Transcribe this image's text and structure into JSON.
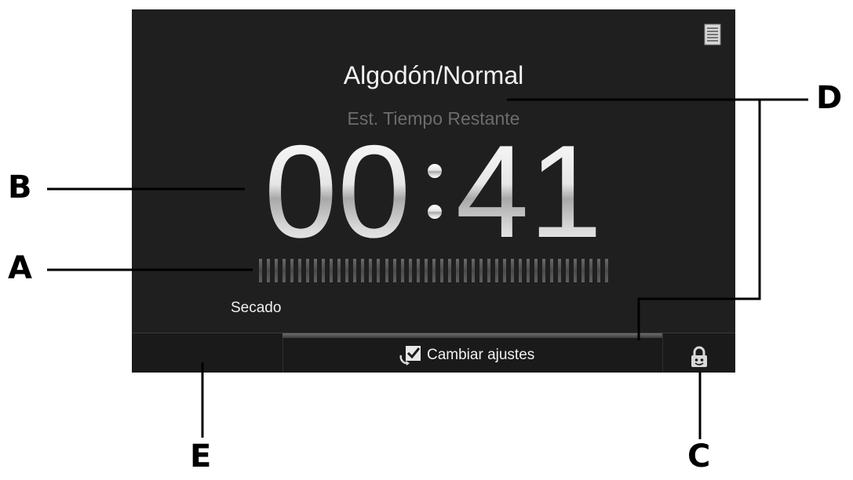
{
  "display": {
    "cycle_name": "Algodón/Normal",
    "est_label": "Est. Tiempo Restante",
    "time": {
      "hours": "00",
      "minutes": "41"
    },
    "progress": {
      "segments": 45,
      "filled": 0
    },
    "phase_label": "Secado",
    "change_settings_label": "Cambiar ajustes",
    "icons": {
      "list": "list-icon",
      "check": "check-settings-icon",
      "lock": "child-lock-icon"
    }
  },
  "callouts": {
    "A": "A",
    "B": "B",
    "C": "C",
    "D": "D",
    "E": "E"
  }
}
